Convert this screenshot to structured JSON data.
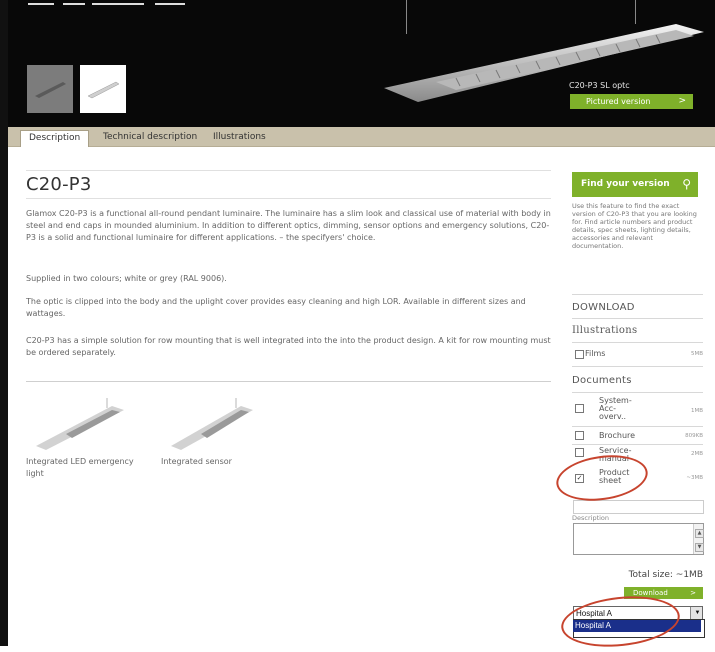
{
  "hero": {
    "caption": "C20-P3 SL optc",
    "pictured_btn": "Pictured version",
    "arrow": ">"
  },
  "tabs": [
    {
      "label": "Description",
      "active": true
    },
    {
      "label": "Technical description",
      "active": false
    },
    {
      "label": "Illustrations",
      "active": false
    }
  ],
  "product": {
    "title": "C20-P3",
    "paragraphs": [
      "Glamox C20-P3 is a functional all-round pendant luminaire. The luminaire has a slim look and classical use of material with body in steel and end caps in mounded aluminium. In addition to different optics, dimming, sensor options and emergency solutions, C20-P3 is a solid and functional luminaire for different applications. – the specifyers' choice.",
      "Supplied in two colours; white or grey (RAL 9006).",
      "The optic is clipped into the body and the uplight cover provides easy cleaning and high LOR. Available in different sizes and wattages.",
      "C20-P3 has a simple solution for row mounting that is well integrated into the into the product design. A kit for row mounting must be ordered separately."
    ],
    "variants": [
      {
        "label": "Integrated LED emergency light"
      },
      {
        "label": "Integrated sensor"
      }
    ]
  },
  "sidebar": {
    "find_label": "Find your version",
    "find_icon": "search-icon",
    "find_text": "Use this feature to find the exact version of C20-P3 that you are looking for. Find article numbers and product details, spec sheets, lighting details, accessories and relevant documentation.",
    "download_heading": "DOWNLOAD",
    "illustrations_heading": "Illustrations",
    "illustrations": [
      {
        "label": "Films",
        "size": "5MB",
        "checked": false
      }
    ],
    "documents_heading": "Documents",
    "documents": [
      {
        "label": "System-Acc-overv..",
        "size": "1MB",
        "checked": false
      },
      {
        "label": "Brochure",
        "size": "809KB",
        "checked": false
      },
      {
        "label": "Service-manual",
        "size": "2MB",
        "checked": false
      },
      {
        "label": "Product sheet",
        "size": "~3MB",
        "checked": true
      }
    ],
    "description_label": "Description",
    "total_size": "Total size: ~1MB",
    "download_btn": "Download",
    "select_value": "Hospital A",
    "select_option": "Hospital A",
    "accent_color": "#7fb12a",
    "annotation_color": "#c7442e"
  }
}
